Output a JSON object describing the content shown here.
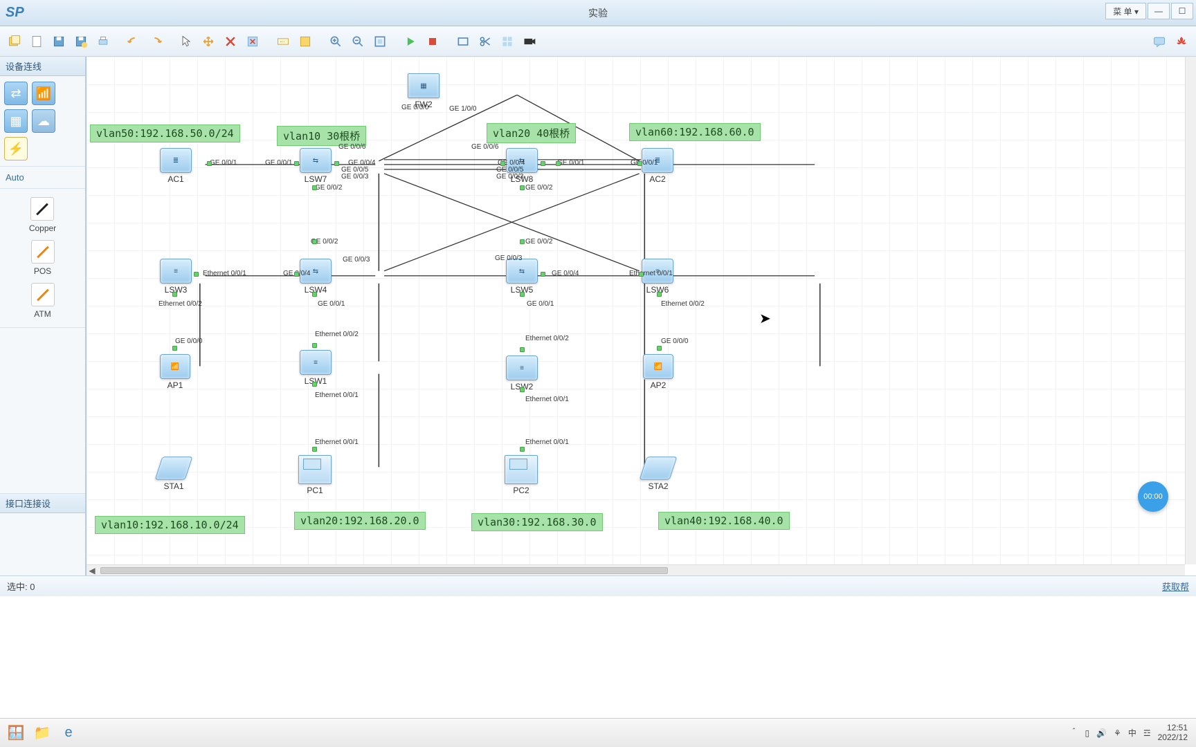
{
  "window": {
    "app": "SP",
    "title": "实验",
    "menu_label": "菜 单 ▾",
    "minimize": "—",
    "maximize": "☐"
  },
  "toolbar": {
    "right_chat": "💬",
    "right_logo": "HW"
  },
  "sidebar": {
    "panel_title": "设备连线",
    "auto": "Auto",
    "cables": [
      {
        "label": "Copper",
        "color": "black"
      },
      {
        "label": "POS",
        "color": "orange"
      },
      {
        "label": "ATM",
        "color": "orange"
      }
    ],
    "bottom_text": "接口连接设"
  },
  "notes": {
    "vlan50": "vlan50:192.168.50.0/24",
    "vlan10root": "vlan10 30根桥",
    "vlan20root": "vlan20 40根桥",
    "vlan60": "vlan60:192.168.60.0",
    "vlan10": "vlan10:192.168.10.0/24",
    "vlan20": "vlan20:192.168.20.0",
    "vlan30": "vlan30:192.168.30.0",
    "vlan40": "vlan40:192.168.40.0"
  },
  "nodes": {
    "FW2": "FW2",
    "AC1": "AC1",
    "LSW7": "LSW7",
    "LSW8": "LSW8",
    "AC2": "AC2",
    "LSW3": "LSW3",
    "LSW4": "LSW4",
    "LSW5": "LSW5",
    "LSW6": "LSW6",
    "AP1": "AP1",
    "LSW1": "LSW1",
    "LSW2": "LSW2",
    "AP2": "AP2",
    "STA1": "STA1",
    "PC1": "PC1",
    "PC2": "PC2",
    "STA2": "STA2"
  },
  "ports": {
    "ge000": "GE 0/0/0",
    "ge001": "GE 0/0/1",
    "ge002": "GE 0/0/2",
    "ge003": "GE 0/0/3",
    "ge004": "GE 0/0/4",
    "ge005": "GE 0/0/5",
    "ge006": "GE 0/0/6",
    "ge100": "GE 1/0/0",
    "eth001": "Ethernet 0/0/1",
    "eth002": "Ethernet 0/0/2"
  },
  "statusbar": {
    "left": "选中: 0",
    "right": "获取帮"
  },
  "timer": "00:00",
  "taskbar": {
    "tray": {
      "ime": "中",
      "kb": "☲"
    },
    "clock_time": "12:51",
    "clock_date": "2022/12"
  }
}
